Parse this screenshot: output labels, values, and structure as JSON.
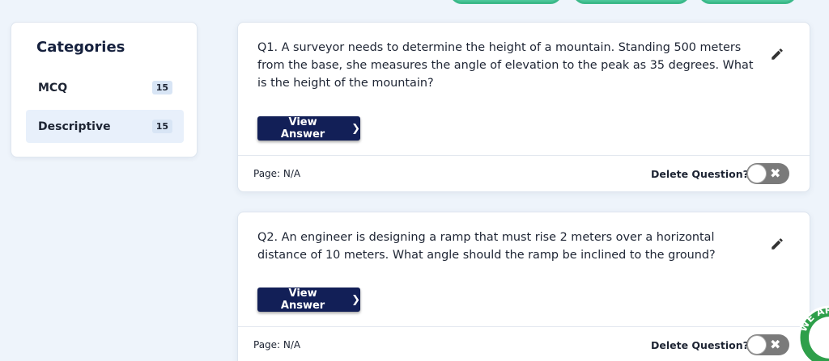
{
  "categories": {
    "title": "Categories",
    "items": [
      {
        "label": "MCQ",
        "count": "15"
      },
      {
        "label": "Descriptive",
        "count": "15"
      }
    ]
  },
  "questions": [
    {
      "text": "Q1. A surveyor needs to determine the height of a mountain. Standing 500 meters from the base, she measures the angle of elevation to the peak as 35 degrees. What is the height of the mountain?",
      "view_answer": "View Answer",
      "page": "Page: N/A",
      "delete_label": "Delete Question?"
    },
    {
      "text": "Q2. An engineer is designing a ramp that must rise 2 meters over a horizontal distance of 10 meters. What angle should the ramp be inclined to the ground?",
      "view_answer": "View Answer",
      "page": "Page: N/A",
      "delete_label": "Delete Question?"
    }
  ],
  "badge": {
    "text": "WE AR"
  },
  "colors": {
    "accent_button": "#121f57",
    "top_pill": "#4cc79a",
    "page_bg": "#eef4fb"
  },
  "icons": [
    "pencil-icon",
    "chevron-right-icon",
    "close-icon"
  ]
}
